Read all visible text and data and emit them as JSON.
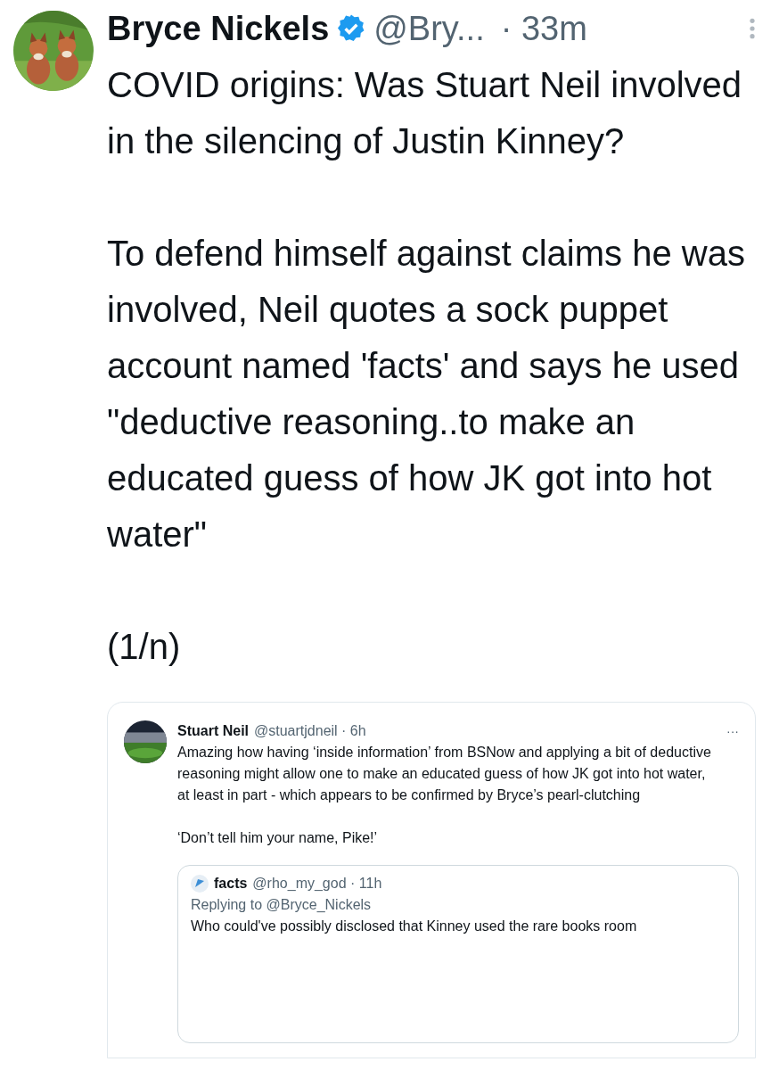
{
  "author": {
    "name": "Bryce Nickels",
    "verified": true,
    "handle": "@Bry...",
    "time": "· 33m"
  },
  "paragraphs": [
    "COVID origins: Was Stuart Neil involved in the silencing of Justin Kinney?",
    "To defend himself against claims he was involved, Neil quotes a sock puppet account named 'facts' and says he used \"deductive reasoning..to make an educated guess of how JK got into hot water\"",
    "(1/n)"
  ],
  "embedded": {
    "name": "Stuart Neil",
    "handle": "@stuartjdneil · 6h",
    "more": "···",
    "paragraphs": [
      "Amazing how having ‘inside information’ from BSNow and applying a bit of deductive reasoning might allow one to make an educated guess of how JK got into hot water, at least in part - which appears to be confirmed by Bryce’s pearl-clutching",
      "‘Don’t tell him your name, Pike!’"
    ],
    "quoted": {
      "name": "facts",
      "handle": "@rho_my_god · 11h",
      "replying": "Replying to @Bryce_Nickels",
      "text": "Who could've possibly disclosed that Kinney used the rare books room"
    }
  }
}
